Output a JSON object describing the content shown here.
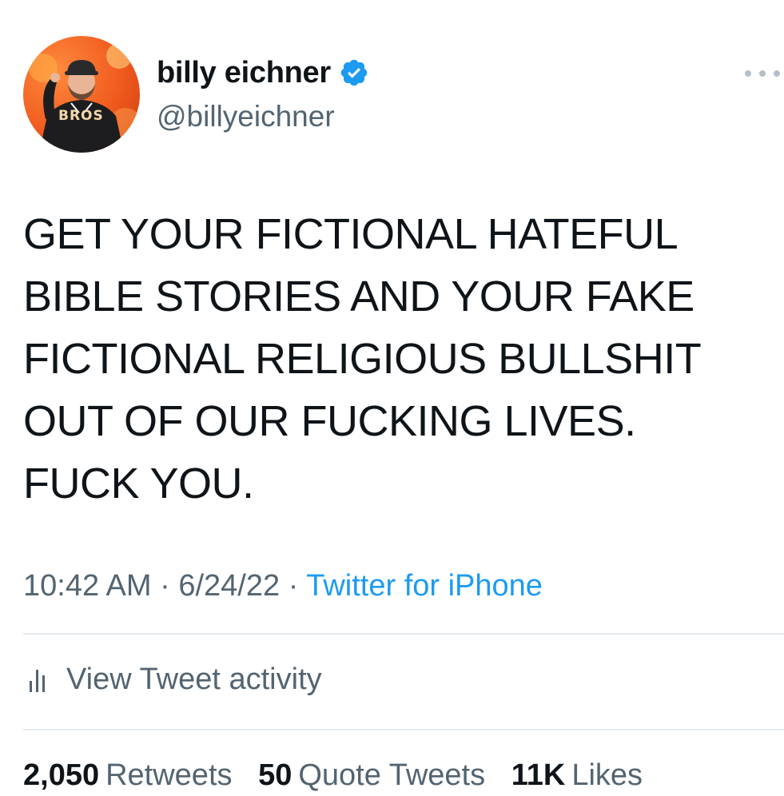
{
  "user": {
    "display_name": "billy eichner",
    "handle": "@billyeichner",
    "verified": true,
    "avatar_jersey_text": "BROS"
  },
  "tweet": {
    "text": "GET YOUR FICTIONAL HATEFUL\nBIBLE STORIES AND YOUR FAKE\nFICTIONAL RELIGIOUS BULLSHIT\nOUT OF OUR FUCKING LIVES.\nFUCK YOU.",
    "time": "10:42 AM",
    "date": "6/24/22",
    "separator": "·",
    "source": "Twitter for iPhone"
  },
  "activity": {
    "label": "View Tweet activity",
    "icon": "bar-chart-icon"
  },
  "stats": {
    "retweets_count": "2,050",
    "retweets_label": "Retweets",
    "quotes_count": "50",
    "quotes_label": "Quote Tweets",
    "likes_count": "11K",
    "likes_label": "Likes"
  },
  "colors": {
    "text_primary": "#0f1419",
    "text_secondary": "#536471",
    "accent": "#1d9bf0",
    "divider": "#e6ecf0",
    "avatar_background": "#f05a1e"
  }
}
